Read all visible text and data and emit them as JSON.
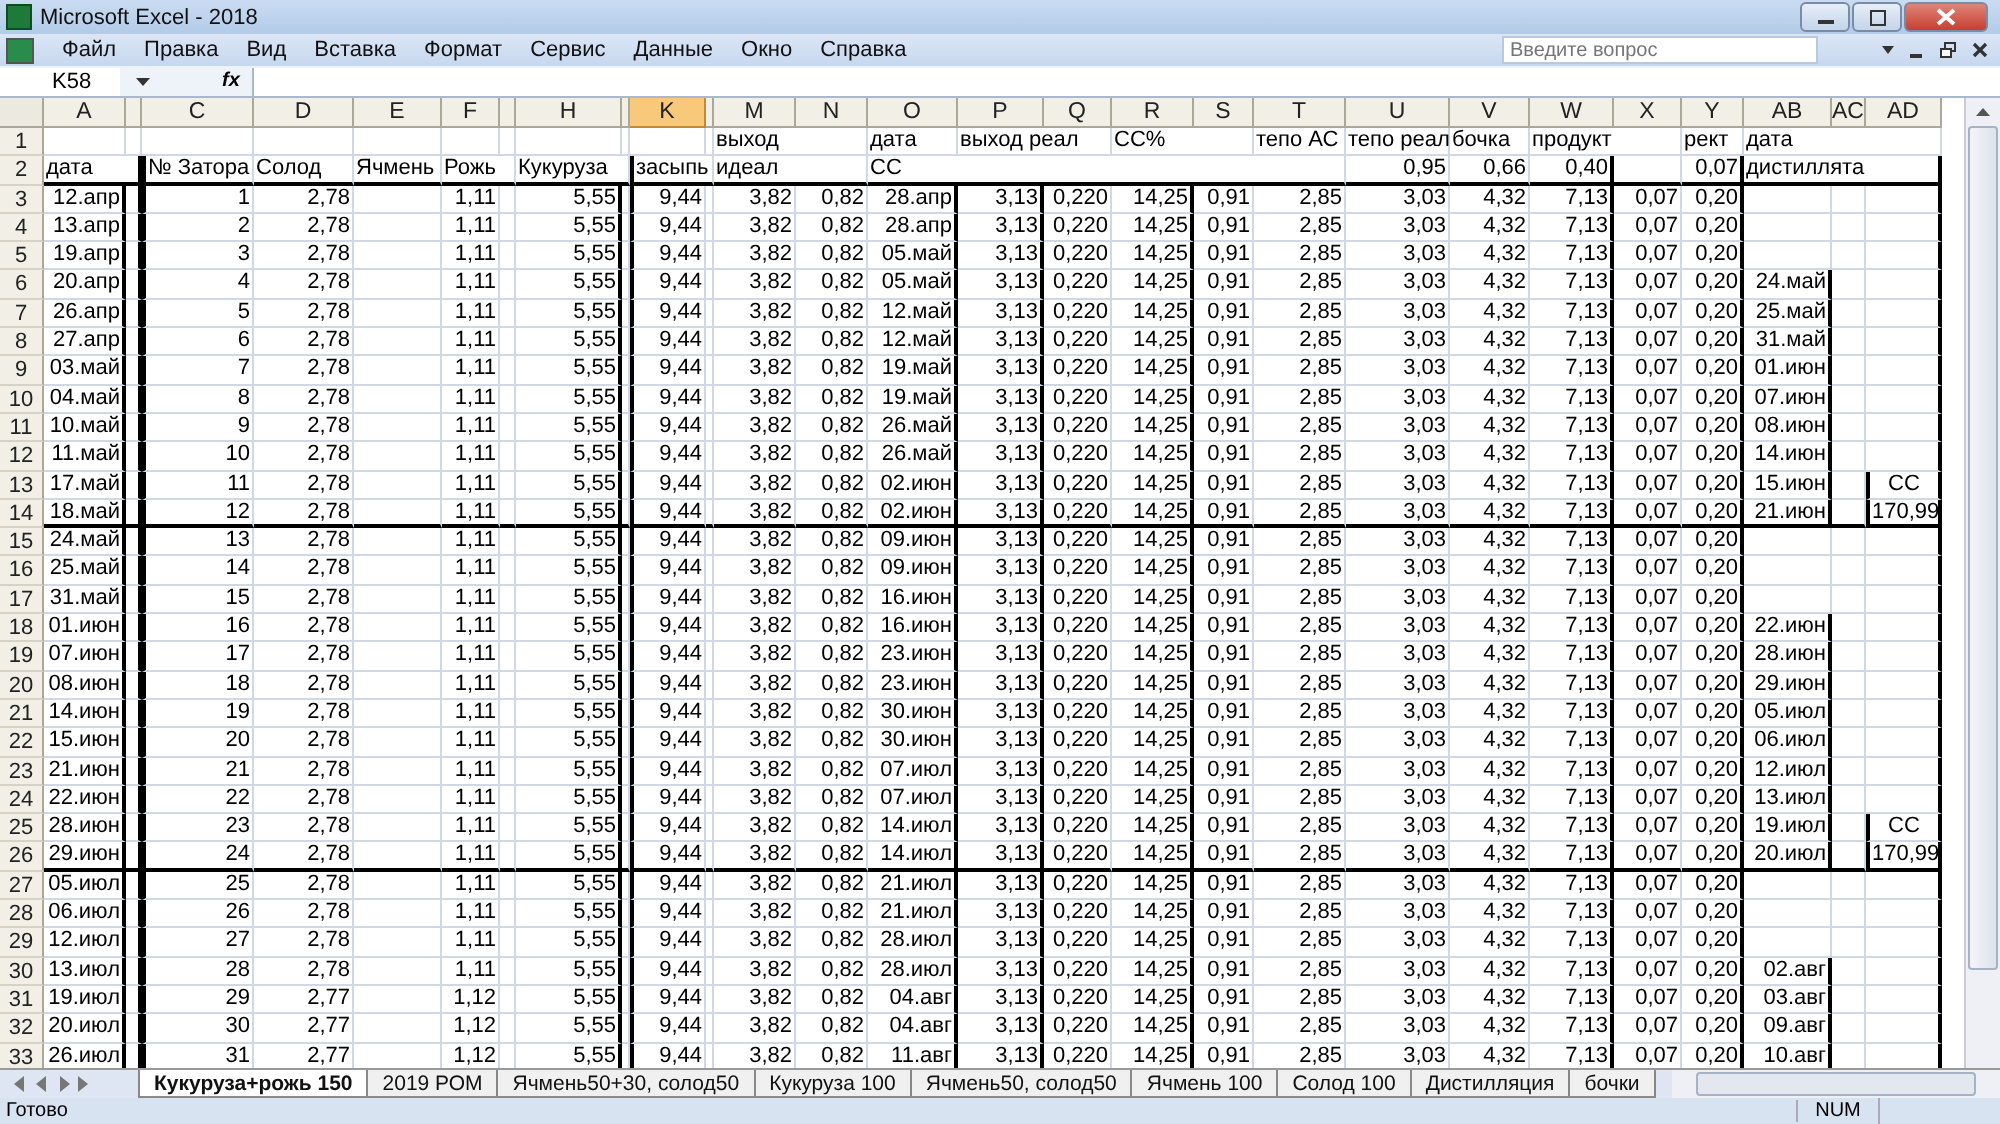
{
  "window": {
    "title": "Microsoft Excel - 2018"
  },
  "menu": [
    "Файл",
    "Правка",
    "Вид",
    "Вставка",
    "Формат",
    "Сервис",
    "Данные",
    "Окно",
    "Справка"
  ],
  "help_search": {
    "placeholder": "Введите вопрос"
  },
  "formula_bar": {
    "name_box": "K58",
    "fx": "fx"
  },
  "columns": [
    {
      "label": "A",
      "selected": false
    },
    {
      "selected": false
    },
    {
      "label": "C",
      "selected": false
    },
    {
      "label": "D",
      "selected": false
    },
    {
      "label": "E",
      "selected": false
    },
    {
      "label": "F",
      "selected": false
    },
    {
      "selected": false
    },
    {
      "label": "H",
      "selected": false
    },
    {
      "selected": false
    },
    {
      "label": "K",
      "selected": true
    },
    {
      "selected": false
    },
    {
      "label": "M",
      "selected": false
    },
    {
      "label": "N",
      "selected": false
    },
    {
      "label": "O",
      "selected": false
    },
    {
      "label": "P",
      "selected": false
    },
    {
      "label": "Q",
      "selected": false
    },
    {
      "label": "R",
      "selected": false
    },
    {
      "label": "S",
      "selected": false
    },
    {
      "label": "T",
      "selected": false
    },
    {
      "label": "U",
      "selected": false
    },
    {
      "label": "V",
      "selected": false
    },
    {
      "label": "W",
      "selected": false
    },
    {
      "label": "X",
      "selected": false
    },
    {
      "label": "Y",
      "selected": false
    },
    {
      "label": "AB",
      "selected": false
    },
    {
      "label": "AC",
      "selected": false
    },
    {
      "label": "AD",
      "selected": false
    }
  ],
  "header_rows": [
    {
      "number": "1",
      "cells": [
        null,
        null,
        null,
        null,
        null,
        null,
        null,
        null,
        null,
        null,
        null,
        {
          "text": "выход",
          "kind": "text"
        },
        null,
        {
          "text": "дата",
          "kind": "text"
        },
        {
          "text": "выход реал",
          "kind": "text"
        },
        null,
        {
          "text": "CC%",
          "kind": "text"
        },
        null,
        {
          "text": "тепо АС",
          "kind": "text"
        },
        {
          "text": "тепо реал",
          "kind": "text"
        },
        {
          "text": "бочка",
          "kind": "text"
        },
        {
          "text": "продукт",
          "kind": "text"
        },
        null,
        {
          "text": "рект",
          "kind": "text"
        },
        {
          "text": "дата",
          "kind": "text"
        },
        null,
        null
      ]
    },
    {
      "number": "2",
      "cells": [
        {
          "text": "дата",
          "kind": "text"
        },
        null,
        {
          "text": "№ Затора",
          "kind": "text"
        },
        {
          "text": "Солод",
          "kind": "text"
        },
        {
          "text": "Ячмень",
          "kind": "text"
        },
        {
          "text": "Рожь",
          "kind": "text"
        },
        null,
        {
          "text": "Кукуруза",
          "kind": "text"
        },
        null,
        {
          "text": "засыпь",
          "kind": "text"
        },
        null,
        {
          "text": "идеал",
          "kind": "text"
        },
        null,
        {
          "text": "CC",
          "kind": "text"
        },
        null,
        null,
        null,
        null,
        null,
        {
          "text": "0,95",
          "kind": "number"
        },
        {
          "text": "0,66",
          "kind": "number"
        },
        {
          "text": "0,40",
          "kind": "number"
        },
        null,
        {
          "text": "0,07",
          "kind": "number"
        },
        {
          "text": "дистиллята",
          "kind": "text"
        },
        null,
        null
      ]
    }
  ],
  "rows": [
    {
      "number": "3",
      "cells": [
        "12.апр",
        null,
        "1",
        "2,78",
        null,
        "1,11",
        null,
        "5,55",
        null,
        "9,44",
        null,
        "3,82",
        "0,82",
        "28.апр",
        "3,13",
        "0,220",
        "14,25",
        "0,91",
        "2,85",
        "3,03",
        "4,32",
        "7,13",
        "0,07",
        "0,20",
        null,
        null,
        null
      ]
    },
    {
      "number": "4",
      "cells": [
        "13.апр",
        null,
        "2",
        "2,78",
        null,
        "1,11",
        null,
        "5,55",
        null,
        "9,44",
        null,
        "3,82",
        "0,82",
        "28.апр",
        "3,13",
        "0,220",
        "14,25",
        "0,91",
        "2,85",
        "3,03",
        "4,32",
        "7,13",
        "0,07",
        "0,20",
        null,
        null,
        null
      ]
    },
    {
      "number": "5",
      "cells": [
        "19.апр",
        null,
        "3",
        "2,78",
        null,
        "1,11",
        null,
        "5,55",
        null,
        "9,44",
        null,
        "3,82",
        "0,82",
        "05.май",
        "3,13",
        "0,220",
        "14,25",
        "0,91",
        "2,85",
        "3,03",
        "4,32",
        "7,13",
        "0,07",
        "0,20",
        null,
        null,
        null
      ]
    },
    {
      "number": "6",
      "cells": [
        "20.апр",
        null,
        "4",
        "2,78",
        null,
        "1,11",
        null,
        "5,55",
        null,
        "9,44",
        null,
        "3,82",
        "0,82",
        "05.май",
        "3,13",
        "0,220",
        "14,25",
        "0,91",
        "2,85",
        "3,03",
        "4,32",
        "7,13",
        "0,07",
        "0,20",
        "24.май",
        null,
        null
      ]
    },
    {
      "number": "7",
      "cells": [
        "26.апр",
        null,
        "5",
        "2,78",
        null,
        "1,11",
        null,
        "5,55",
        null,
        "9,44",
        null,
        "3,82",
        "0,82",
        "12.май",
        "3,13",
        "0,220",
        "14,25",
        "0,91",
        "2,85",
        "3,03",
        "4,32",
        "7,13",
        "0,07",
        "0,20",
        "25.май",
        null,
        null
      ]
    },
    {
      "number": "8",
      "cells": [
        "27.апр",
        null,
        "6",
        "2,78",
        null,
        "1,11",
        null,
        "5,55",
        null,
        "9,44",
        null,
        "3,82",
        "0,82",
        "12.май",
        "3,13",
        "0,220",
        "14,25",
        "0,91",
        "2,85",
        "3,03",
        "4,32",
        "7,13",
        "0,07",
        "0,20",
        "31.май",
        null,
        null
      ]
    },
    {
      "number": "9",
      "cells": [
        "03.май",
        null,
        "7",
        "2,78",
        null,
        "1,11",
        null,
        "5,55",
        null,
        "9,44",
        null,
        "3,82",
        "0,82",
        "19.май",
        "3,13",
        "0,220",
        "14,25",
        "0,91",
        "2,85",
        "3,03",
        "4,32",
        "7,13",
        "0,07",
        "0,20",
        "01.июн",
        null,
        null
      ]
    },
    {
      "number": "10",
      "cells": [
        "04.май",
        null,
        "8",
        "2,78",
        null,
        "1,11",
        null,
        "5,55",
        null,
        "9,44",
        null,
        "3,82",
        "0,82",
        "19.май",
        "3,13",
        "0,220",
        "14,25",
        "0,91",
        "2,85",
        "3,03",
        "4,32",
        "7,13",
        "0,07",
        "0,20",
        "07.июн",
        null,
        null
      ]
    },
    {
      "number": "11",
      "cells": [
        "10.май",
        null,
        "9",
        "2,78",
        null,
        "1,11",
        null,
        "5,55",
        null,
        "9,44",
        null,
        "3,82",
        "0,82",
        "26.май",
        "3,13",
        "0,220",
        "14,25",
        "0,91",
        "2,85",
        "3,03",
        "4,32",
        "7,13",
        "0,07",
        "0,20",
        "08.июн",
        null,
        null
      ]
    },
    {
      "number": "12",
      "cells": [
        "11.май",
        null,
        "10",
        "2,78",
        null,
        "1,11",
        null,
        "5,55",
        null,
        "9,44",
        null,
        "3,82",
        "0,82",
        "26.май",
        "3,13",
        "0,220",
        "14,25",
        "0,91",
        "2,85",
        "3,03",
        "4,32",
        "7,13",
        "0,07",
        "0,20",
        "14.июн",
        null,
        null
      ]
    },
    {
      "number": "13",
      "cells": [
        "17.май",
        null,
        "11",
        "2,78",
        null,
        "1,11",
        null,
        "5,55",
        null,
        "9,44",
        null,
        "3,82",
        "0,82",
        "02.июн",
        "3,13",
        "0,220",
        "14,25",
        "0,91",
        "2,85",
        "3,03",
        "4,32",
        "7,13",
        "0,07",
        "0,20",
        "15.июн",
        null,
        "CC"
      ]
    },
    {
      "number": "14",
      "cells": [
        "18.май",
        null,
        "12",
        "2,78",
        null,
        "1,11",
        null,
        "5,55",
        null,
        "9,44",
        null,
        "3,82",
        "0,82",
        "02.июн",
        "3,13",
        "0,220",
        "14,25",
        "0,91",
        "2,85",
        "3,03",
        "4,32",
        "7,13",
        "0,07",
        "0,20",
        "21.июн",
        null,
        "170,99"
      ]
    },
    {
      "number": "15",
      "cells": [
        "24.май",
        null,
        "13",
        "2,78",
        null,
        "1,11",
        null,
        "5,55",
        null,
        "9,44",
        null,
        "3,82",
        "0,82",
        "09.июн",
        "3,13",
        "0,220",
        "14,25",
        "0,91",
        "2,85",
        "3,03",
        "4,32",
        "7,13",
        "0,07",
        "0,20",
        null,
        null,
        null
      ]
    },
    {
      "number": "16",
      "cells": [
        "25.май",
        null,
        "14",
        "2,78",
        null,
        "1,11",
        null,
        "5,55",
        null,
        "9,44",
        null,
        "3,82",
        "0,82",
        "09.июн",
        "3,13",
        "0,220",
        "14,25",
        "0,91",
        "2,85",
        "3,03",
        "4,32",
        "7,13",
        "0,07",
        "0,20",
        null,
        null,
        null
      ]
    },
    {
      "number": "17",
      "cells": [
        "31.май",
        null,
        "15",
        "2,78",
        null,
        "1,11",
        null,
        "5,55",
        null,
        "9,44",
        null,
        "3,82",
        "0,82",
        "16.июн",
        "3,13",
        "0,220",
        "14,25",
        "0,91",
        "2,85",
        "3,03",
        "4,32",
        "7,13",
        "0,07",
        "0,20",
        null,
        null,
        null
      ]
    },
    {
      "number": "18",
      "cells": [
        "01.июн",
        null,
        "16",
        "2,78",
        null,
        "1,11",
        null,
        "5,55",
        null,
        "9,44",
        null,
        "3,82",
        "0,82",
        "16.июн",
        "3,13",
        "0,220",
        "14,25",
        "0,91",
        "2,85",
        "3,03",
        "4,32",
        "7,13",
        "0,07",
        "0,20",
        "22.июн",
        null,
        null
      ]
    },
    {
      "number": "19",
      "cells": [
        "07.июн",
        null,
        "17",
        "2,78",
        null,
        "1,11",
        null,
        "5,55",
        null,
        "9,44",
        null,
        "3,82",
        "0,82",
        "23.июн",
        "3,13",
        "0,220",
        "14,25",
        "0,91",
        "2,85",
        "3,03",
        "4,32",
        "7,13",
        "0,07",
        "0,20",
        "28.июн",
        null,
        null
      ]
    },
    {
      "number": "20",
      "cells": [
        "08.июн",
        null,
        "18",
        "2,78",
        null,
        "1,11",
        null,
        "5,55",
        null,
        "9,44",
        null,
        "3,82",
        "0,82",
        "23.июн",
        "3,13",
        "0,220",
        "14,25",
        "0,91",
        "2,85",
        "3,03",
        "4,32",
        "7,13",
        "0,07",
        "0,20",
        "29.июн",
        null,
        null
      ]
    },
    {
      "number": "21",
      "cells": [
        "14.июн",
        null,
        "19",
        "2,78",
        null,
        "1,11",
        null,
        "5,55",
        null,
        "9,44",
        null,
        "3,82",
        "0,82",
        "30.июн",
        "3,13",
        "0,220",
        "14,25",
        "0,91",
        "2,85",
        "3,03",
        "4,32",
        "7,13",
        "0,07",
        "0,20",
        "05.июл",
        null,
        null
      ]
    },
    {
      "number": "22",
      "cells": [
        "15.июн",
        null,
        "20",
        "2,78",
        null,
        "1,11",
        null,
        "5,55",
        null,
        "9,44",
        null,
        "3,82",
        "0,82",
        "30.июн",
        "3,13",
        "0,220",
        "14,25",
        "0,91",
        "2,85",
        "3,03",
        "4,32",
        "7,13",
        "0,07",
        "0,20",
        "06.июл",
        null,
        null
      ]
    },
    {
      "number": "23",
      "cells": [
        "21.июн",
        null,
        "21",
        "2,78",
        null,
        "1,11",
        null,
        "5,55",
        null,
        "9,44",
        null,
        "3,82",
        "0,82",
        "07.июл",
        "3,13",
        "0,220",
        "14,25",
        "0,91",
        "2,85",
        "3,03",
        "4,32",
        "7,13",
        "0,07",
        "0,20",
        "12.июл",
        null,
        null
      ]
    },
    {
      "number": "24",
      "cells": [
        "22.июн",
        null,
        "22",
        "2,78",
        null,
        "1,11",
        null,
        "5,55",
        null,
        "9,44",
        null,
        "3,82",
        "0,82",
        "07.июл",
        "3,13",
        "0,220",
        "14,25",
        "0,91",
        "2,85",
        "3,03",
        "4,32",
        "7,13",
        "0,07",
        "0,20",
        "13.июл",
        null,
        null
      ]
    },
    {
      "number": "25",
      "cells": [
        "28.июн",
        null,
        "23",
        "2,78",
        null,
        "1,11",
        null,
        "5,55",
        null,
        "9,44",
        null,
        "3,82",
        "0,82",
        "14.июл",
        "3,13",
        "0,220",
        "14,25",
        "0,91",
        "2,85",
        "3,03",
        "4,32",
        "7,13",
        "0,07",
        "0,20",
        "19.июл",
        null,
        "CC"
      ]
    },
    {
      "number": "26",
      "cells": [
        "29.июн",
        null,
        "24",
        "2,78",
        null,
        "1,11",
        null,
        "5,55",
        null,
        "9,44",
        null,
        "3,82",
        "0,82",
        "14.июл",
        "3,13",
        "0,220",
        "14,25",
        "0,91",
        "2,85",
        "3,03",
        "4,32",
        "7,13",
        "0,07",
        "0,20",
        "20.июл",
        null,
        "170,99"
      ]
    },
    {
      "number": "27",
      "cells": [
        "05.июл",
        null,
        "25",
        "2,78",
        null,
        "1,11",
        null,
        "5,55",
        null,
        "9,44",
        null,
        "3,82",
        "0,82",
        "21.июл",
        "3,13",
        "0,220",
        "14,25",
        "0,91",
        "2,85",
        "3,03",
        "4,32",
        "7,13",
        "0,07",
        "0,20",
        null,
        null,
        null
      ]
    },
    {
      "number": "28",
      "cells": [
        "06.июл",
        null,
        "26",
        "2,78",
        null,
        "1,11",
        null,
        "5,55",
        null,
        "9,44",
        null,
        "3,82",
        "0,82",
        "21.июл",
        "3,13",
        "0,220",
        "14,25",
        "0,91",
        "2,85",
        "3,03",
        "4,32",
        "7,13",
        "0,07",
        "0,20",
        null,
        null,
        null
      ]
    },
    {
      "number": "29",
      "cells": [
        "12.июл",
        null,
        "27",
        "2,78",
        null,
        "1,11",
        null,
        "5,55",
        null,
        "9,44",
        null,
        "3,82",
        "0,82",
        "28.июл",
        "3,13",
        "0,220",
        "14,25",
        "0,91",
        "2,85",
        "3,03",
        "4,32",
        "7,13",
        "0,07",
        "0,20",
        null,
        null,
        null
      ]
    },
    {
      "number": "30",
      "cells": [
        "13.июл",
        null,
        "28",
        "2,78",
        null,
        "1,11",
        null,
        "5,55",
        null,
        "9,44",
        null,
        "3,82",
        "0,82",
        "28.июл",
        "3,13",
        "0,220",
        "14,25",
        "0,91",
        "2,85",
        "3,03",
        "4,32",
        "7,13",
        "0,07",
        "0,20",
        "02.авг",
        null,
        null
      ]
    },
    {
      "number": "31",
      "cells": [
        "19.июл",
        null,
        "29",
        "2,77",
        null,
        "1,12",
        null,
        "5,55",
        null,
        "9,44",
        null,
        "3,82",
        "0,82",
        "04.авг",
        "3,13",
        "0,220",
        "14,25",
        "0,91",
        "2,85",
        "3,03",
        "4,32",
        "7,13",
        "0,07",
        "0,20",
        "03.авг",
        null,
        null
      ]
    },
    {
      "number": "32",
      "cells": [
        "20.июл",
        null,
        "30",
        "2,77",
        null,
        "1,12",
        null,
        "5,55",
        null,
        "9,44",
        null,
        "3,82",
        "0,82",
        "04.авг",
        "3,13",
        "0,220",
        "14,25",
        "0,91",
        "2,85",
        "3,03",
        "4,32",
        "7,13",
        "0,07",
        "0,20",
        "09.авг",
        null,
        null
      ]
    },
    {
      "number": "33",
      "cells": [
        "26.июл",
        null,
        "31",
        "2,77",
        null,
        "1,12",
        null,
        "5,55",
        null,
        "9,44",
        null,
        "3,82",
        "0,82",
        "11.авг",
        "3,13",
        "0,220",
        "14,25",
        "0,91",
        "2,85",
        "3,03",
        "4,32",
        "7,13",
        "0,07",
        "0,20",
        "10.авг",
        null,
        null
      ]
    }
  ],
  "sheet_tabs": [
    {
      "label": "Кукуруза+рожь 150",
      "selected": true
    },
    {
      "label": "2019 РОМ",
      "selected": false
    },
    {
      "label": "Ячмень50+30, солод50",
      "selected": false
    },
    {
      "label": "Кукуруза 100",
      "selected": false
    },
    {
      "label": "Ячмень50, солод50",
      "selected": false
    },
    {
      "label": "Ячмень 100",
      "selected": false
    },
    {
      "label": "Солод 100",
      "selected": false
    },
    {
      "label": "Дистилляция",
      "selected": false
    },
    {
      "label": "бочки",
      "selected": false
    }
  ],
  "status_bar": {
    "text": "Готово",
    "indicators": [
      "NUM"
    ]
  }
}
